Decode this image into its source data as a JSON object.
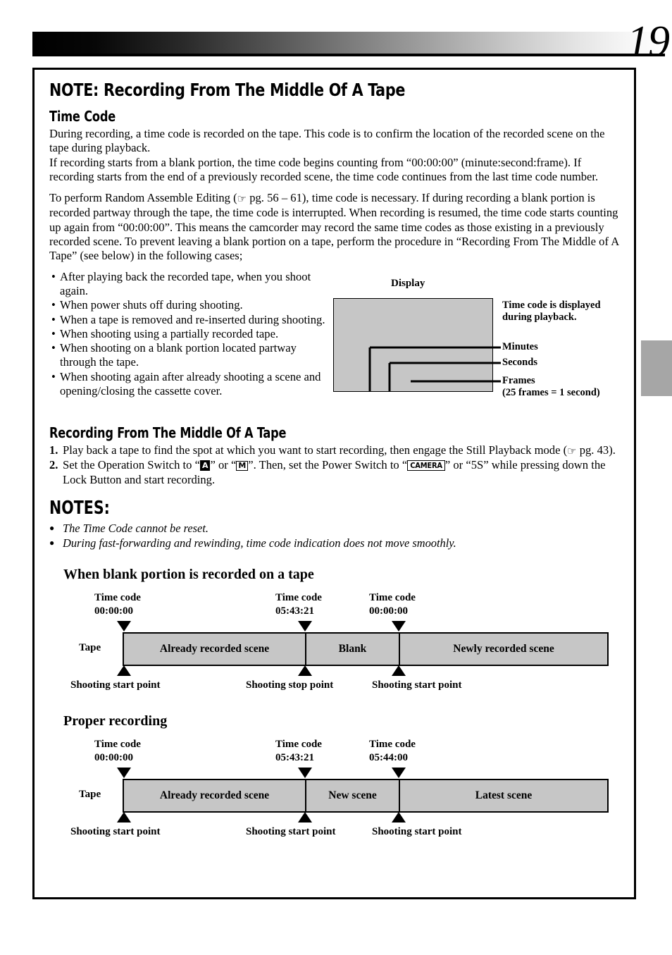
{
  "page": {
    "number": "19"
  },
  "edge_tab": {
    "color": "#a6a6a6"
  },
  "main_heading": "NOTE: Recording From The Middle Of A Tape",
  "time_code": {
    "heading": "Time Code",
    "para1": "During recording, a time code is recorded on the tape. This code is to confirm the location of the recorded scene on the tape during playback.",
    "para2": "If recording starts from a blank portion, the time code begins counting from “00:00:00” (minute:second:frame). If recording starts from the end of a previously recorded scene, the time code continues from the last time code number.",
    "para3_a": "To perform Random Assemble Editing (",
    "para3_hand": "☞",
    "para3_b": " pg. 56 – 61), time code is necessary. If during recording a blank portion is recorded partway through the tape, the time code is interrupted. When recording is resumed, the time code starts counting up again from “00:00:00”. This means the camcorder may record the same time codes as those existing in a previously recorded scene. To prevent leaving a blank portion on a tape, perform the procedure in “Recording From The Middle of A Tape” (see below) in the following cases;"
  },
  "bullets": [
    "After playing back the recorded tape, when you shoot again.",
    "When power shuts off during shooting.",
    "When a tape is removed and re-inserted during shooting.",
    "When shooting using a partially recorded tape.",
    "When shooting on a blank portion located partway through the tape.",
    "When shooting again after already shooting a scene and opening/closing the cassette cover."
  ],
  "bullet_dot": "•",
  "display_figure": {
    "caption": "Display",
    "note_line1": "Time code is displayed",
    "note_line2": "during playback.",
    "label_minutes": "Minutes",
    "label_seconds": "Seconds",
    "label_frames": "Frames",
    "label_frames_sub": "(25 frames = 1 second)",
    "box_color": "#c6c6c6"
  },
  "procedure": {
    "heading": "Recording From The Middle Of A Tape",
    "step1_num": "1.",
    "step1_a": "Play back a tape to find the spot at which you want to start recording, then engage the Still Playback mode (",
    "step1_hand": "☞",
    "step1_b": " pg. 43).",
    "step2_num": "2.",
    "step2_a": "Set the Operation Switch to “",
    "step2_badge_a": "A",
    "step2_b": "” or “",
    "step2_badge_m": "M",
    "step2_c": "”. Then, set the Power Switch to “",
    "step2_badge_camera": "CAMERA",
    "step2_d": "” or “5S” while pressing down the Lock Button and start recording."
  },
  "notes": {
    "heading": "NOTES:",
    "dot": "●",
    "items": [
      "The Time Code cannot be reset.",
      "During fast-forwarding and rewinding, time code indication does not move smoothly."
    ]
  },
  "diagram_blank": {
    "title": "When blank portion is recorded on a tape",
    "tape_label": "Tape",
    "codes": [
      {
        "line1": "Time code",
        "line2": "00:00:00"
      },
      {
        "line1": "Time code",
        "line2": "05:43:21"
      },
      {
        "line1": "Time code",
        "line2": "00:00:00"
      }
    ],
    "segments": [
      {
        "label": "Already recorded scene"
      },
      {
        "label": "Blank"
      },
      {
        "label": "Newly recorded scene"
      }
    ],
    "feet": [
      "Shooting start point",
      "Shooting stop point",
      "Shooting start point"
    ]
  },
  "diagram_proper": {
    "title": "Proper recording",
    "tape_label": "Tape",
    "codes": [
      {
        "line1": "Time code",
        "line2": "00:00:00"
      },
      {
        "line1": "Time code",
        "line2": "05:43:21"
      },
      {
        "line1": "Time code",
        "line2": "05:44:00"
      }
    ],
    "segments": [
      {
        "label": "Already recorded scene"
      },
      {
        "label": "New scene"
      },
      {
        "label": "Latest scene"
      }
    ],
    "feet": [
      "Shooting start point",
      "Shooting start point",
      "Shooting start point"
    ]
  }
}
